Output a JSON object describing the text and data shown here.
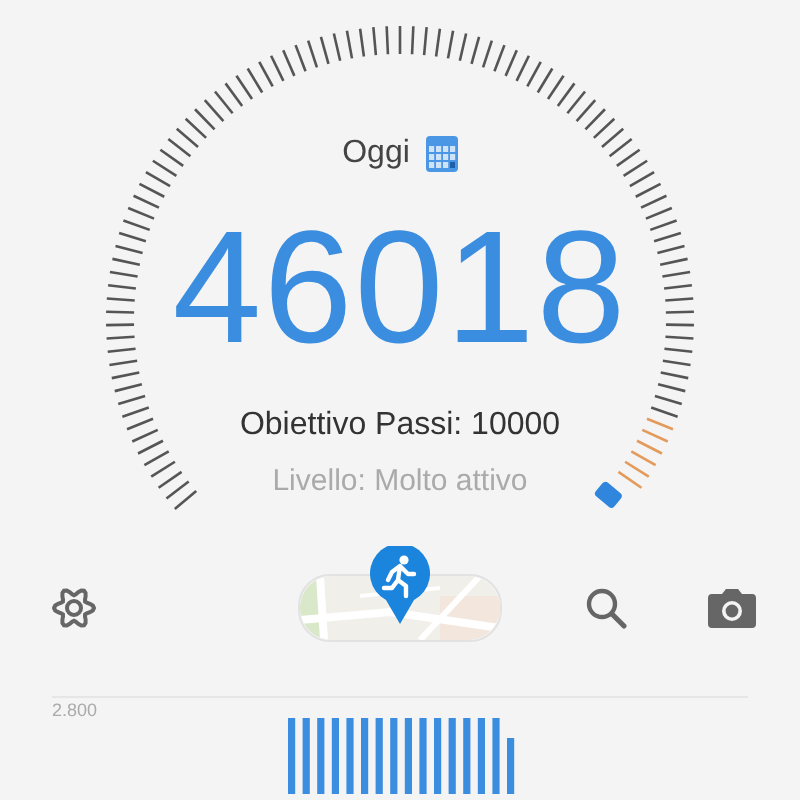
{
  "date": {
    "label": "Oggi"
  },
  "steps": "46018",
  "goal": "Obiettivo Passi: 10000",
  "activity_level": "Livello: Molto attivo",
  "chart": {
    "y_tick_label": "2.800"
  }
}
